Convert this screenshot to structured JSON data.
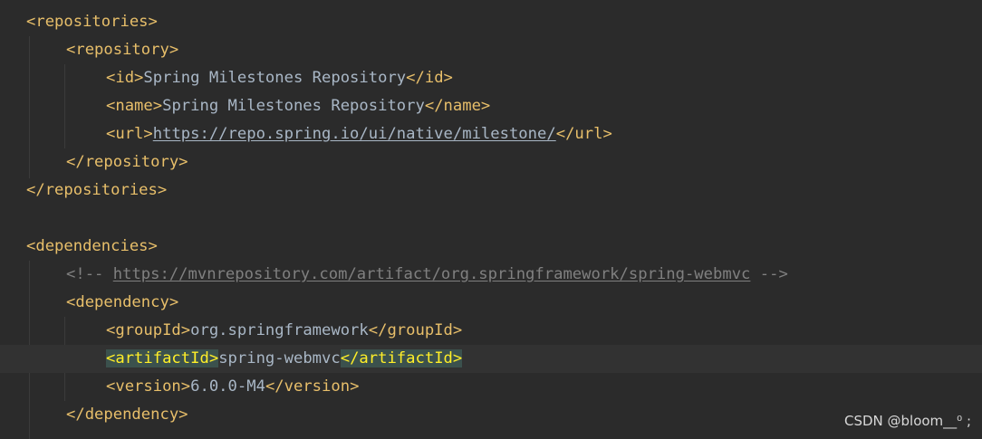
{
  "editor": {
    "lines": [
      {
        "segments": [
          {
            "cls": "tag",
            "text": "<repositories>"
          }
        ]
      },
      {
        "segments": [
          {
            "cls": "tag",
            "text": "<repository>"
          }
        ]
      },
      {
        "segments": [
          {
            "cls": "tag",
            "text": "<id>"
          },
          {
            "cls": "txt",
            "text": "Spring Milestones Repository"
          },
          {
            "cls": "tag",
            "text": "</id>"
          }
        ]
      },
      {
        "segments": [
          {
            "cls": "tag",
            "text": "<name>"
          },
          {
            "cls": "txt",
            "text": "Spring Milestones Repository"
          },
          {
            "cls": "tag",
            "text": "</name>"
          }
        ]
      },
      {
        "segments": [
          {
            "cls": "tag",
            "text": "<url>"
          },
          {
            "cls": "link",
            "text": "https://repo.spring.io/ui/native/milestone/"
          },
          {
            "cls": "tag",
            "text": "</url>"
          }
        ]
      },
      {
        "segments": [
          {
            "cls": "tag",
            "text": "</repository>"
          }
        ]
      },
      {
        "segments": [
          {
            "cls": "tag",
            "text": "</repositories>"
          }
        ]
      },
      {
        "segments": []
      },
      {
        "segments": [
          {
            "cls": "tag",
            "text": "<dependencies>"
          }
        ]
      },
      {
        "segments": [
          {
            "cls": "comment",
            "text": "<!-- "
          },
          {
            "cls": "comment-link",
            "text": "https://mvnrepository.com/artifact/org.springframework/spring-webmvc"
          },
          {
            "cls": "comment",
            "text": " -->"
          }
        ]
      },
      {
        "segments": [
          {
            "cls": "tag",
            "text": "<dependency>"
          }
        ]
      },
      {
        "segments": [
          {
            "cls": "tag",
            "text": "<groupId>"
          },
          {
            "cls": "txt",
            "text": "org.springframework"
          },
          {
            "cls": "tag",
            "text": "</groupId>"
          }
        ]
      },
      {
        "segments": [
          {
            "cls": "tag hl",
            "text": "<artifactId>"
          },
          {
            "cls": "txt",
            "text": "spring-webmvc"
          },
          {
            "cls": "tag hl",
            "text": "</artifactId>"
          }
        ]
      },
      {
        "segments": [
          {
            "cls": "tag",
            "text": "<version>"
          },
          {
            "cls": "txt",
            "text": "6.0.0-M4"
          },
          {
            "cls": "tag",
            "text": "</version>"
          }
        ]
      },
      {
        "segments": [
          {
            "cls": "tag",
            "text": "</dependency>"
          }
        ]
      }
    ]
  },
  "watermark": "CSDN @bloom__⁰ ;",
  "colors": {
    "background": "#2b2b2b",
    "tag": "#e8bf6a",
    "text": "#a9b7c6",
    "comment": "#808080",
    "highlight_bg": "#3b514d",
    "current_line": "#323232"
  }
}
